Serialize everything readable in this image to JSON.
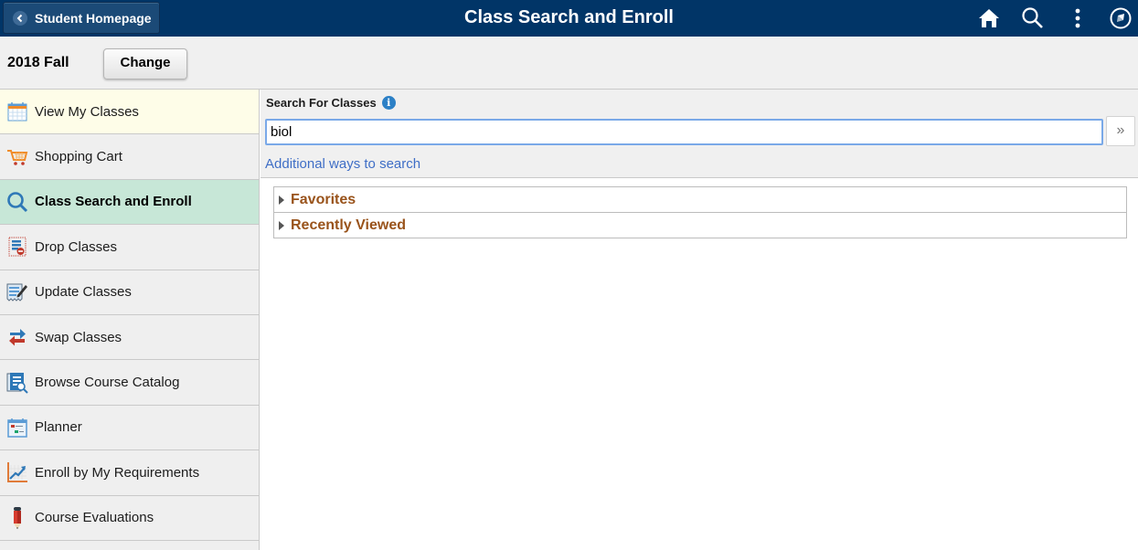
{
  "header": {
    "back_label": "Student Homepage",
    "title": "Class Search and Enroll",
    "icons": [
      "home-icon",
      "search-icon",
      "more-actions-icon",
      "navbar-compass-icon"
    ]
  },
  "term": {
    "label": "2018 Fall",
    "change_label": "Change"
  },
  "sidebar": {
    "items": [
      {
        "label": "View My Classes",
        "icon": "calendar-icon",
        "state": "current"
      },
      {
        "label": "Shopping Cart",
        "icon": "shopping-cart-icon",
        "state": ""
      },
      {
        "label": "Class Search and Enroll",
        "icon": "magnifier-icon",
        "state": "active"
      },
      {
        "label": "Drop Classes",
        "icon": "drop-list-icon",
        "state": ""
      },
      {
        "label": "Update Classes",
        "icon": "edit-document-icon",
        "state": ""
      },
      {
        "label": "Swap Classes",
        "icon": "swap-arrows-icon",
        "state": ""
      },
      {
        "label": "Browse Course Catalog",
        "icon": "catalog-search-icon",
        "state": ""
      },
      {
        "label": "Planner",
        "icon": "planner-calendar-icon",
        "state": ""
      },
      {
        "label": "Enroll by My Requirements",
        "icon": "growth-chart-icon",
        "state": ""
      },
      {
        "label": "Course Evaluations",
        "icon": "pencil-icon",
        "state": ""
      }
    ]
  },
  "search": {
    "label": "Search For Classes",
    "value": "biol",
    "placeholder": "",
    "go_label": "»",
    "additional_link": "Additional ways to search"
  },
  "groups": [
    {
      "label": "Favorites",
      "expanded": false
    },
    {
      "label": "Recently Viewed",
      "expanded": false
    }
  ],
  "colors": {
    "header_bg": "#013567",
    "active_item_bg": "#c7e7d7",
    "current_item_bg": "#fefde8",
    "group_label": "#99531b",
    "link": "#3f6ec6"
  }
}
